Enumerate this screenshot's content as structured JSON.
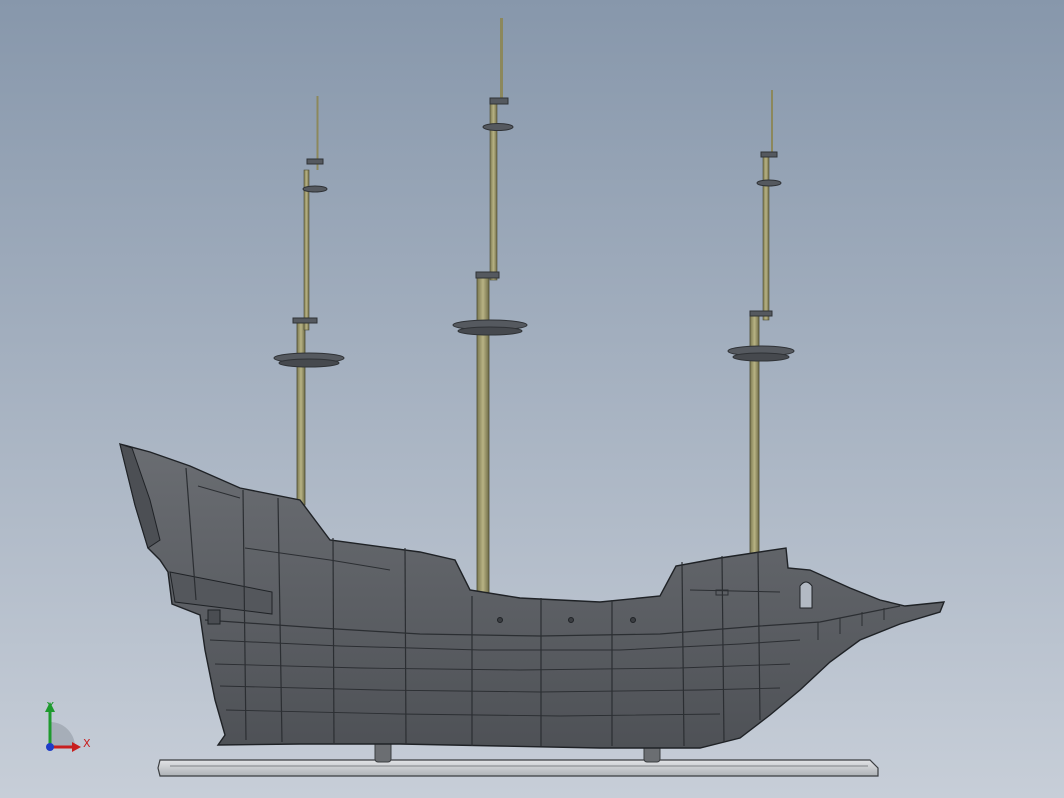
{
  "viewport": {
    "background_top": "#8797ab",
    "background_bottom": "#c7ced8"
  },
  "model": {
    "hull_color": "#5c5f64",
    "mast_color": "#9e9a6a",
    "top_color": "#55595f",
    "stand_color": "#cfd2d4"
  },
  "triad": {
    "x_label": "X",
    "y_label": "Y",
    "x_color": "#c81e1e",
    "y_color": "#1e9a2e",
    "z_color": "#1e3cc8"
  }
}
